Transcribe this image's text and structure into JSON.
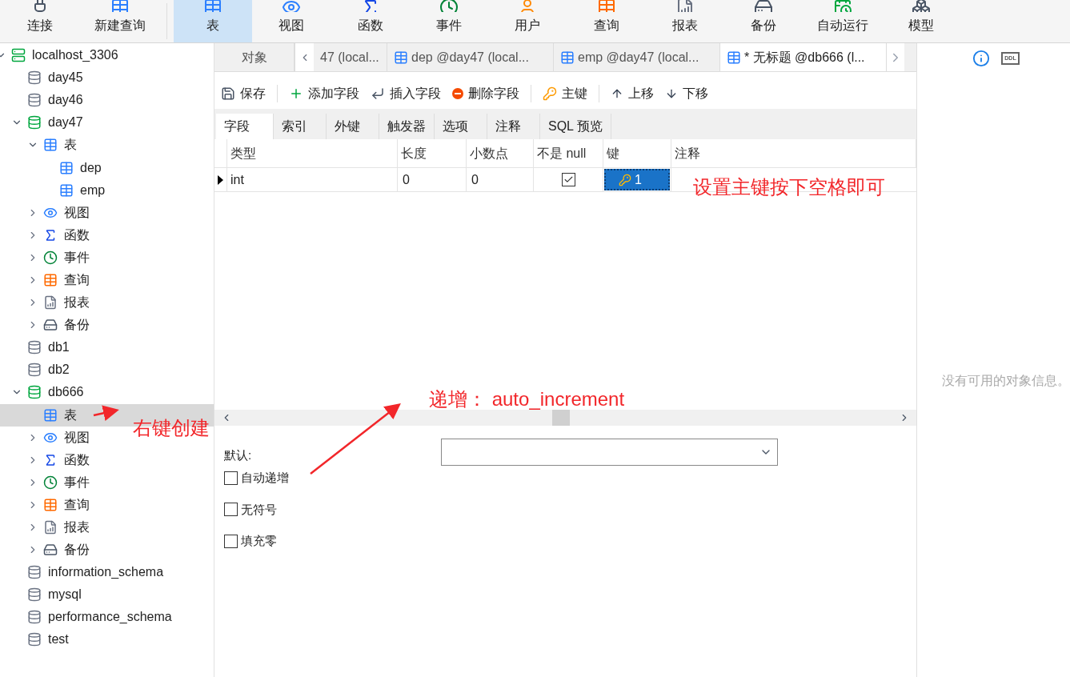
{
  "toolbar": {
    "items": [
      {
        "label": "连接",
        "kind": "connect",
        "selected": false
      },
      {
        "label": "新建查询",
        "kind": "query-new",
        "selected": false
      },
      {
        "label": "表",
        "kind": "tables",
        "selected": true
      },
      {
        "label": "视图",
        "kind": "views",
        "selected": false
      },
      {
        "label": "函数",
        "kind": "functions",
        "selected": false
      },
      {
        "label": "事件",
        "kind": "events",
        "selected": false
      },
      {
        "label": "用户",
        "kind": "users",
        "selected": false
      },
      {
        "label": "查询",
        "kind": "queries",
        "selected": false
      },
      {
        "label": "报表",
        "kind": "reports",
        "selected": false
      },
      {
        "label": "备份",
        "kind": "backups",
        "selected": false
      },
      {
        "label": "自动运行",
        "kind": "schedule",
        "selected": false
      },
      {
        "label": "模型",
        "kind": "model",
        "selected": false
      }
    ]
  },
  "sidebar": {
    "tree": [
      {
        "label": "localhost_3306",
        "kind": "server",
        "expanded": true,
        "selected": false,
        "children": [
          {
            "label": "day45",
            "kind": "database",
            "selected": false
          },
          {
            "label": "day46",
            "kind": "database",
            "selected": false
          },
          {
            "label": "day47",
            "kind": "database",
            "expanded": true,
            "selected": false,
            "children": [
              {
                "label": "表",
                "kind": "tables",
                "expanded": true,
                "selected": false,
                "children": [
                  {
                    "label": "dep",
                    "kind": "table",
                    "selected": false
                  },
                  {
                    "label": "emp",
                    "kind": "table",
                    "selected": false
                  }
                ]
              },
              {
                "label": "视图",
                "kind": "views",
                "expanded": false,
                "selected": false
              },
              {
                "label": "函数",
                "kind": "functions",
                "expanded": false,
                "selected": false
              },
              {
                "label": "事件",
                "kind": "events",
                "expanded": false,
                "selected": false
              },
              {
                "label": "查询",
                "kind": "queries",
                "expanded": false,
                "selected": false
              },
              {
                "label": "报表",
                "kind": "reports",
                "expanded": false,
                "selected": false
              },
              {
                "label": "备份",
                "kind": "backups",
                "expanded": false,
                "selected": false
              }
            ]
          },
          {
            "label": "db1",
            "kind": "database",
            "selected": false
          },
          {
            "label": "db2",
            "kind": "database",
            "selected": false
          },
          {
            "label": "db666",
            "kind": "database",
            "expanded": true,
            "selected": false,
            "children": [
              {
                "label": "表",
                "kind": "tables-leaf",
                "selected": true
              },
              {
                "label": "视图",
                "kind": "views",
                "expanded": false,
                "selected": false
              },
              {
                "label": "函数",
                "kind": "functions",
                "expanded": false,
                "selected": false
              },
              {
                "label": "事件",
                "kind": "events",
                "expanded": false,
                "selected": false
              },
              {
                "label": "查询",
                "kind": "queries",
                "expanded": false,
                "selected": false
              },
              {
                "label": "报表",
                "kind": "reports",
                "expanded": false,
                "selected": false
              },
              {
                "label": "备份",
                "kind": "backups",
                "expanded": false,
                "selected": false
              }
            ]
          },
          {
            "label": "information_schema",
            "kind": "database",
            "selected": false
          },
          {
            "label": "mysql",
            "kind": "database",
            "selected": false
          },
          {
            "label": "performance_schema",
            "kind": "database",
            "selected": false
          },
          {
            "label": "test",
            "kind": "database",
            "selected": false
          }
        ]
      }
    ]
  },
  "tabs": [
    {
      "label": "对象",
      "kind": "objects",
      "selected": false
    },
    {
      "label": "47 (local...",
      "kind": "cut",
      "selected": false
    },
    {
      "label": "dep @day47 (local...",
      "kind": "design",
      "selected": false
    },
    {
      "label": "emp @day47 (local...",
      "kind": "design",
      "selected": false
    },
    {
      "label": "* 无标题 @db666 (l...",
      "kind": "design",
      "selected": true
    }
  ],
  "editor_toolbar": [
    {
      "label": "保存",
      "kind": "save"
    },
    {
      "label": "添加字段",
      "kind": "add"
    },
    {
      "label": "插入字段",
      "kind": "insert"
    },
    {
      "label": "删除字段",
      "kind": "delete"
    },
    {
      "label": "主键",
      "kind": "key"
    },
    {
      "label": "上移",
      "kind": "up"
    },
    {
      "label": "下移",
      "kind": "down"
    }
  ],
  "subtabs": [
    {
      "label": "字段",
      "selected": true
    },
    {
      "label": "索引",
      "selected": false
    },
    {
      "label": "外键",
      "selected": false
    },
    {
      "label": "触发器",
      "selected": false
    },
    {
      "label": "选项",
      "selected": false
    },
    {
      "label": "注释",
      "selected": false
    },
    {
      "label": "SQL 预览",
      "selected": false
    }
  ],
  "fields_table": {
    "columns": [
      "类型",
      "长度",
      "小数点",
      "不是 null",
      "键",
      "注释"
    ],
    "rows": [
      {
        "current": true,
        "type": "int",
        "length": "0",
        "decimals": "0",
        "not_null": true,
        "key": "1"
      }
    ]
  },
  "properties": {
    "default_label": "默认:",
    "options": [
      {
        "label": "自动递增",
        "checked": false
      },
      {
        "label": "无符号",
        "checked": false
      },
      {
        "label": "填充零",
        "checked": false
      }
    ]
  },
  "info_panel": {
    "ddl_label": "DDL",
    "message": "没有可用的对象信息。"
  },
  "annotations": [
    {
      "text": "设置主键按下空格即可",
      "kind": "note-key"
    },
    {
      "text": "递增： auto_increment",
      "kind": "note-increment"
    },
    {
      "text": "右键创建",
      "kind": "note-create"
    }
  ]
}
